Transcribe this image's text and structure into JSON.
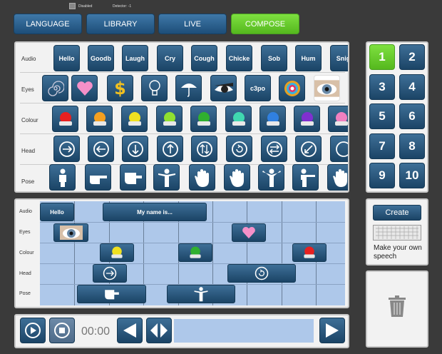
{
  "status": {
    "checkbox_label": "Disabled",
    "detector": "Detector: -1"
  },
  "tabs": [
    {
      "label": "LANGUAGE",
      "active": false
    },
    {
      "label": "LIBRARY",
      "active": false
    },
    {
      "label": "LIVE",
      "active": false
    },
    {
      "label": "COMPOSE",
      "active": true
    }
  ],
  "library": {
    "rows": [
      {
        "label": "Audio",
        "items": [
          "Hello",
          "Goodb",
          "Laugh",
          "Cry",
          "Cough",
          "Chicke",
          "Sob",
          "Hum",
          "Snig"
        ]
      },
      {
        "label": "Eyes",
        "items": [
          "spiral-icon",
          "heart-icon",
          "dollar-icon",
          "lightbulb-icon",
          "umbrella-icon",
          "eye-dark-icon",
          "c3po",
          "starburst-icon",
          "real-eye-icon"
        ]
      },
      {
        "label": "Colour",
        "colors": [
          "#e82020",
          "#f5a020",
          "#f0e020",
          "#90e030",
          "#30b030",
          "#40d8b0",
          "#3080e0",
          "#8030d0",
          "#f080c0"
        ]
      },
      {
        "label": "Head",
        "items": [
          "head-right-icon",
          "head-left-icon",
          "head-down-icon",
          "head-up-icon",
          "head-updown-icon",
          "head-rotate-icon",
          "head-swap-icon",
          "head-tilt-icon",
          "head-more-icon"
        ]
      },
      {
        "label": "Pose",
        "items": [
          "stand-icon",
          "point-right-icon",
          "point-hand-icon",
          "arms-out-icon",
          "palm-icon",
          "wave-icon",
          "shrug-icon",
          "point-side-icon",
          "hand-more-icon"
        ]
      }
    ]
  },
  "slots": [
    "1",
    "2",
    "3",
    "4",
    "5",
    "6",
    "7",
    "8",
    "9",
    "10"
  ],
  "active_slot": "1",
  "create": {
    "button_label": "Create",
    "text": "Make your own speech"
  },
  "timeline": {
    "rows": [
      "Audio",
      "Eyes",
      "Colour",
      "Head",
      "Pose"
    ],
    "audio_clips": [
      "Hello",
      "My name is..."
    ]
  },
  "playback": {
    "time": "00:00"
  },
  "colors": {
    "accent": "#66cc2a",
    "button": "#1f4a6e",
    "timeline_bg": "#aec8ea"
  }
}
